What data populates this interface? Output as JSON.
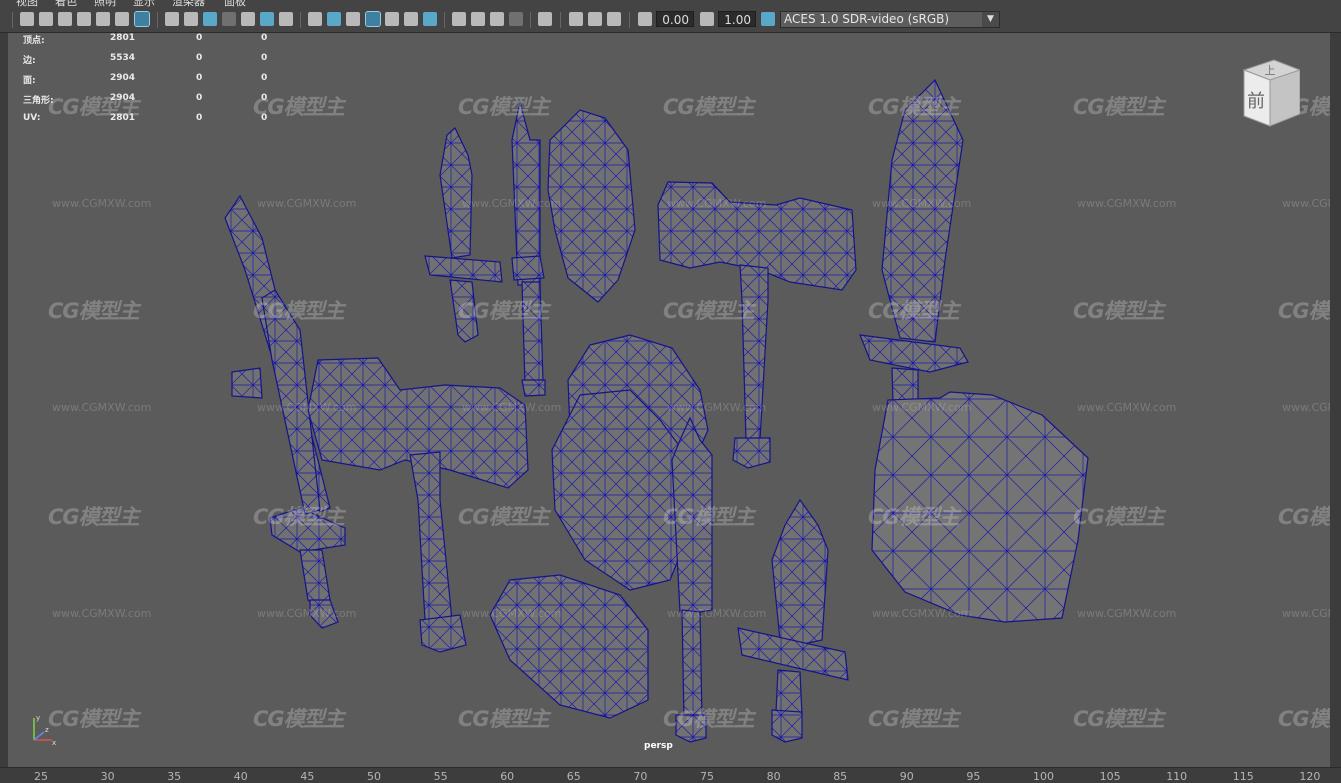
{
  "menubar": {
    "items": [
      "视图",
      "着色",
      "照明",
      "显示",
      "渲染器",
      "面板"
    ]
  },
  "toolbar": {
    "exposure_value": "0.00",
    "gamma_value": "1.00",
    "color_space": "ACES 1.0 SDR-video (sRGB)",
    "icons": [
      "camera-select-icon",
      "camera-attributes-icon",
      "bookmark-icon",
      "bookmark-list-icon",
      "image-plane-icon",
      "grease-pencil-icon",
      "grid-icon",
      "film-gate-icon",
      "resolution-gate-icon",
      "gate-mask-icon",
      "field-chart-icon",
      "safe-title-icon",
      "wireframe-icon",
      "smooth-shade-icon",
      "default-material-icon",
      "wireframe-on-shaded-icon",
      "textured-icon",
      "use-all-lights-icon",
      "shadows-icon",
      "ambient-occlusion-icon",
      "motion-blur-icon",
      "anti-aliasing-icon",
      "depth-of-field-icon",
      "isolate-select-icon",
      "xray-icon",
      "xray-active-icon",
      "xray-joints-icon",
      "exposure-icon",
      "gamma-icon",
      "color-management-icon"
    ]
  },
  "hud": {
    "rows": [
      {
        "label": "顶点:",
        "values": [
          "2801",
          "0",
          "0"
        ]
      },
      {
        "label": "边:",
        "values": [
          "5534",
          "0",
          "0"
        ]
      },
      {
        "label": "面:",
        "values": [
          "2904",
          "0",
          "0"
        ]
      },
      {
        "label": "三角形:",
        "values": [
          "2904",
          "0",
          "0"
        ]
      },
      {
        "label": "UV:",
        "values": [
          "2801",
          "0",
          "0"
        ]
      }
    ]
  },
  "viewcube": {
    "top_face": "上",
    "front_face": "前"
  },
  "camera_label": "persp",
  "axis": {
    "x": "x",
    "y": "y",
    "z": "z"
  },
  "watermark": {
    "logo": "CG模型主",
    "url": "www.CGMXW.com"
  },
  "colors": {
    "background": "#5b5b5b",
    "wire": "#1a1aa0",
    "mesh_fill": "#707070",
    "accent": "#5aa8c9"
  },
  "ruler": {
    "ticks": [
      "25",
      "30",
      "35",
      "40",
      "45",
      "50",
      "55",
      "60",
      "65",
      "70",
      "75",
      "80",
      "85",
      "90",
      "95",
      "100",
      "105",
      "110",
      "115",
      "120"
    ]
  }
}
